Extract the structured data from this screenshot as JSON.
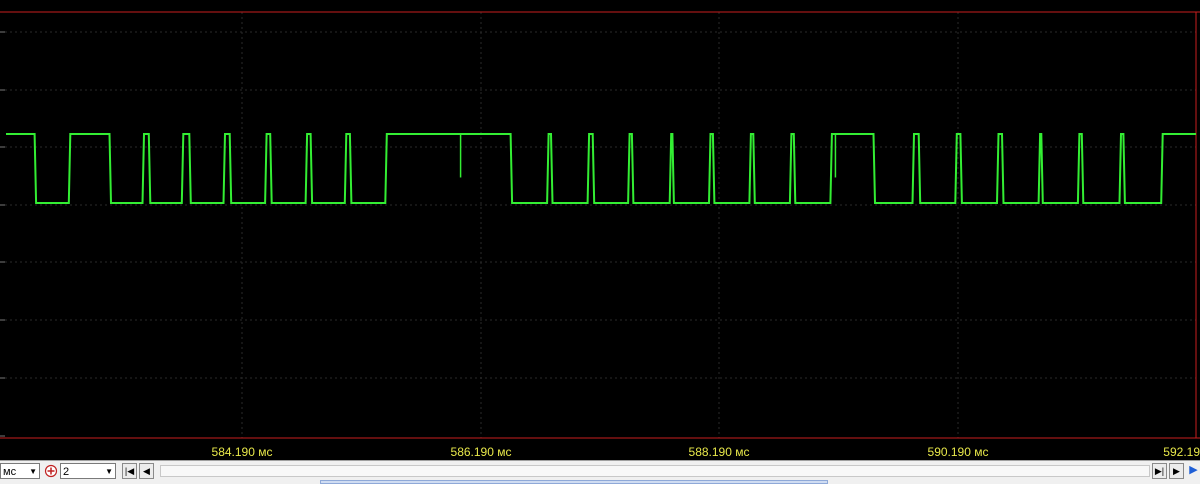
{
  "colors": {
    "background": "#000000",
    "trace": "#33ee33",
    "grid": "#2a2a2a",
    "border": "#c81e1e",
    "timestamp": "#e8e84a"
  },
  "timeline": {
    "labels": [
      "584.190 мс",
      "586.190 мс",
      "588.190 мс",
      "590.190 мс",
      "592.19"
    ]
  },
  "trace": {
    "channel": "2",
    "high_level": 1,
    "low_level": 0,
    "pulses": [
      {
        "t0": 0.024,
        "t1": 0.054
      },
      {
        "t0": 0.087,
        "t1": 0.116
      },
      {
        "t0": 0.12,
        "t1": 0.149
      },
      {
        "t0": 0.154,
        "t1": 0.184
      },
      {
        "t0": 0.188,
        "t1": 0.219
      },
      {
        "t0": 0.222,
        "t1": 0.253
      },
      {
        "t0": 0.256,
        "t1": 0.286
      },
      {
        "t0": 0.289,
        "t1": 0.32
      },
      {
        "t0": 0.424,
        "t1": 0.456
      },
      {
        "t0": 0.458,
        "t1": 0.49
      },
      {
        "t0": 0.493,
        "t1": 0.524
      },
      {
        "t0": 0.526,
        "t1": 0.559
      },
      {
        "t0": 0.56,
        "t1": 0.592
      },
      {
        "t0": 0.594,
        "t1": 0.626
      },
      {
        "t0": 0.628,
        "t1": 0.66
      },
      {
        "t0": 0.662,
        "t1": 0.694
      },
      {
        "t0": 0.729,
        "t1": 0.763
      },
      {
        "t0": 0.767,
        "t1": 0.799
      },
      {
        "t0": 0.802,
        "t1": 0.834
      },
      {
        "t0": 0.837,
        "t1": 0.869
      },
      {
        "t0": 0.87,
        "t1": 0.902
      },
      {
        "t0": 0.904,
        "t1": 0.937
      },
      {
        "t0": 0.939,
        "t1": 0.972
      }
    ],
    "glitches": [
      {
        "t": 0.382,
        "depth": 0.63
      },
      {
        "t": 0.697,
        "depth": 0.63
      }
    ]
  },
  "toolbar": {
    "units_value": "мс",
    "channel_value": "2",
    "first_label": "|◀",
    "prev_label": "◀",
    "next_label": "▶|",
    "last_label": "▶"
  }
}
